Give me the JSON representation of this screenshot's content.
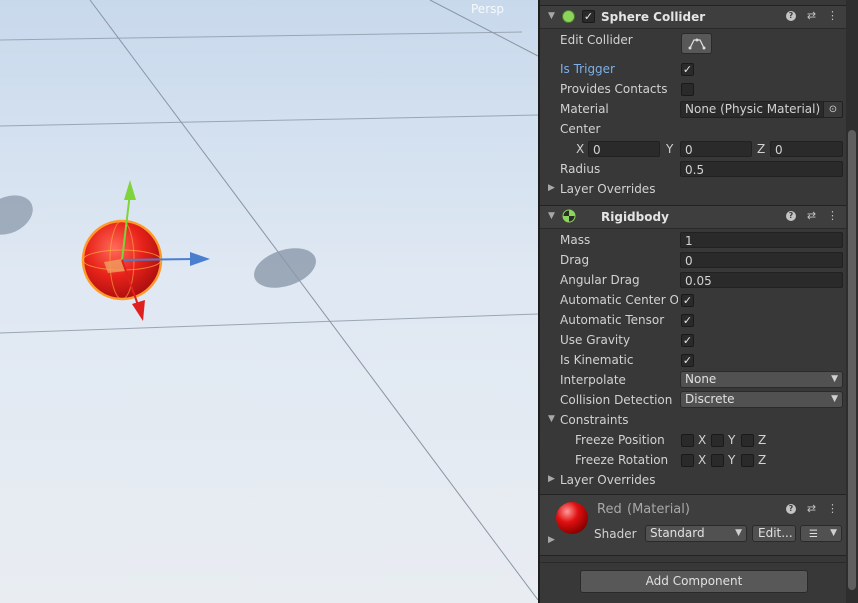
{
  "scene": {
    "view_label": "Persp"
  },
  "sphere_collider": {
    "title": "Sphere Collider",
    "enabled": true,
    "edit_collider_label": "Edit Collider",
    "is_trigger_label": "Is Trigger",
    "is_trigger": true,
    "provides_contacts_label": "Provides Contacts",
    "provides_contacts": false,
    "material_label": "Material",
    "material_value": "None (Physic Material)",
    "center_label": "Center",
    "center": {
      "x_label": "X",
      "x": "0",
      "y_label": "Y",
      "y": "0",
      "z_label": "Z",
      "z": "0"
    },
    "radius_label": "Radius",
    "radius": "0.5",
    "layer_overrides_label": "Layer Overrides"
  },
  "rigidbody": {
    "title": "Rigidbody",
    "mass_label": "Mass",
    "mass": "1",
    "drag_label": "Drag",
    "drag": "0",
    "angular_drag_label": "Angular Drag",
    "angular_drag": "0.05",
    "auto_center_label": "Automatic Center Of I",
    "auto_center": true,
    "auto_tensor_label": "Automatic Tensor",
    "auto_tensor": true,
    "use_gravity_label": "Use Gravity",
    "use_gravity": true,
    "is_kinematic_label": "Is Kinematic",
    "is_kinematic": true,
    "interpolate_label": "Interpolate",
    "interpolate_value": "None",
    "collision_label": "Collision Detection",
    "collision_value": "Discrete",
    "constraints_label": "Constraints",
    "freeze_position_label": "Freeze Position",
    "freeze_rotation_label": "Freeze Rotation",
    "axis_x": "X",
    "axis_y": "Y",
    "axis_z": "Z",
    "layer_overrides_label": "Layer Overrides"
  },
  "material": {
    "name": "Red",
    "type": "(Material)",
    "shader_label": "Shader",
    "shader_value": "Standard",
    "edit_label": "Edit..."
  },
  "add_component_label": "Add Component",
  "icons": {
    "help": "help-icon",
    "presets": "presets-icon",
    "menu": "kebab-menu-icon",
    "collider": "sphere-collider-icon",
    "rigidbody": "rigidbody-icon",
    "edit_collider": "edit-collider-icon",
    "object_picker": "object-picker-icon"
  },
  "colors": {
    "label_blue": "#7cb0e8",
    "panel": "#383838",
    "header": "#3e3e3e",
    "sphere": "#e8231a"
  }
}
